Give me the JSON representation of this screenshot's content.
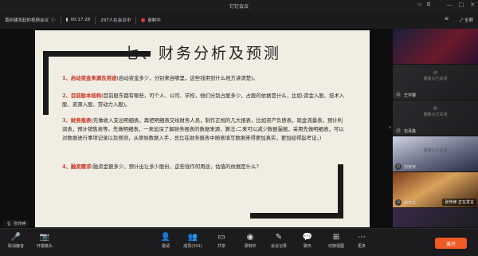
{
  "window": {
    "title": "钉钉会议",
    "icons": [
      "monitor-icon",
      "layout-icon",
      "minimize-icon",
      "maximize-icon",
      "close-icon"
    ]
  },
  "infobar": {
    "meeting_name": "黄树建发起的视频会议",
    "timer": "00:17:28",
    "participants": "297人在会议中",
    "recording": "录制中",
    "right_items": [
      "",
      "全屏"
    ]
  },
  "slide": {
    "title": "七、财务分析及预测",
    "paragraphs": [
      {
        "highlight": "1、启动资金来源及用途",
        "text": "(启动资金多少，分别来自哪里，这些钱用到什么地方讲清楚)。"
      },
      {
        "highlight": "2、目前股本结构",
        "text": "(目前股东都有哪些，可个人、公司、学校，他们分别占股多少，占股的依据是什么，比如:资金入股、技术入股、资源入股、劳动力入股)。"
      },
      {
        "highlight": "3、财务报表",
        "text": "(先做收入支出明细表，再把明细表交给财务人员，制作正规的几大报表，比如资产负债表，现金流量表，预计利润表，预计销售表等。先做明细表，一来加深了解财务报表的数据来源，算法:二来可以减少数据漏报，采用先做明细表，可以对数据进行事项记录以及预测，从原始数据入手，总比在财务报表中随意填写数据来得更加真实，更加经得起考证。)"
      },
      {
        "highlight": "4、融资需求",
        "text": "(融资金额多少，预计出让多少股份，这些钱作何用途，估值的依据是什么?"
      }
    ]
  },
  "participants_panel": {
    "tiles": [
      {
        "name": "",
        "camera_off": "摄像头已关闭",
        "type": "image"
      },
      {
        "name": "王宇娜",
        "camera_off": "摄像头已关闭",
        "type": "off"
      },
      {
        "name": "包泽鑫",
        "camera_off": "摄像头已关闭",
        "type": "off"
      },
      {
        "name": "刘安存",
        "camera_off": "摄像头已关闭",
        "type": "image"
      },
      {
        "name": "宋宇文",
        "camera_off": "",
        "type": "image",
        "speaking": "张传绅  正在发言"
      }
    ]
  },
  "mic_indicator": "张传绅",
  "toolbar": {
    "buttons": [
      {
        "label": "取消静音",
        "icon": "mic-icon"
      },
      {
        "label": "开摄像头",
        "icon": "camera-icon"
      },
      {
        "label": "邀请",
        "icon": "invite-icon"
      },
      {
        "label": "成员(301)",
        "icon": "members-icon"
      },
      {
        "label": "共享",
        "icon": "share-icon"
      },
      {
        "label": "录制中",
        "icon": "record-icon"
      },
      {
        "label": "会议记录",
        "icon": "notes-icon"
      },
      {
        "label": "聊天",
        "icon": "chat-icon"
      },
      {
        "label": "切换视图",
        "icon": "view-icon"
      },
      {
        "label": "更多",
        "icon": "more-icon"
      }
    ],
    "leave_label": "离开"
  },
  "colors": {
    "accent": "#f05a24",
    "highlight_text": "#c83020",
    "recording": "#e03b3b"
  }
}
